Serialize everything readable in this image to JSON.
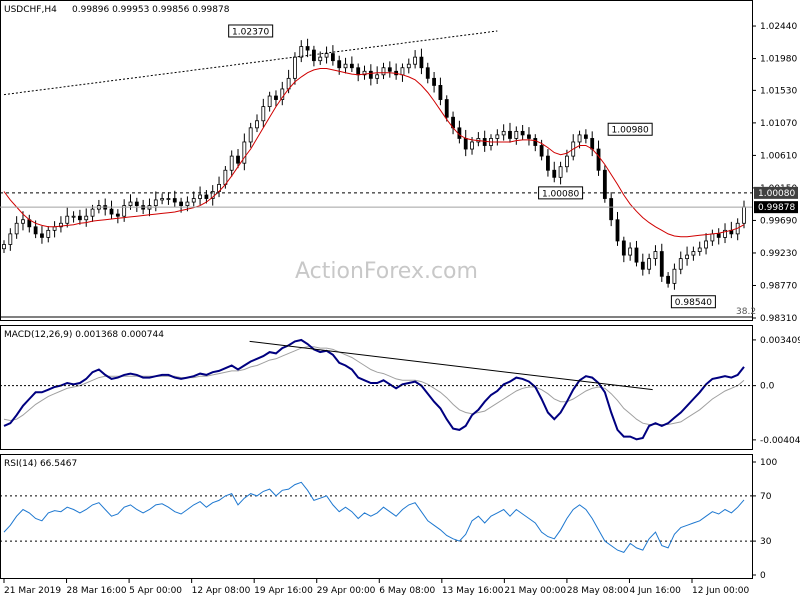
{
  "header": {
    "symbol": "USDCHF,H4",
    "ohlc": "0.99896 0.99953 0.99856 0.99878"
  },
  "watermark": "ActionForex.com",
  "chart_data": [
    {
      "type": "candlestick",
      "title": "USDCHF,H4",
      "ylim": [
        0.9831,
        1.0278
      ],
      "y_ticks": [
        "1.02440",
        "1.01980",
        "1.01530",
        "1.01070",
        "1.00610",
        "1.00150",
        "0.99690",
        "0.99230",
        "0.98770",
        "0.98310"
      ],
      "x_ticks": [
        "21 Mar 2019",
        "28 Mar 16:00",
        "5 Apr 00:00",
        "12 Apr 08:00",
        "19 Apr 16:00",
        "29 Apr 00:00",
        "6 May 08:00",
        "13 May 16:00",
        "21 May 00:00",
        "28 May 08:00",
        "4 Jun 16:00",
        "12 Jun 00:00"
      ],
      "last_price": "0.99878",
      "levels": [
        {
          "label": "1.00080",
          "value": 1.0008
        }
      ],
      "annotations": [
        {
          "label": "1.02370",
          "value": 1.0237
        },
        {
          "label": "1.00980",
          "value": 1.0098
        },
        {
          "label": "1.00080",
          "value": 1.0008
        },
        {
          "label": "0.98540",
          "value": 0.9854
        }
      ],
      "fib_label": "38.2",
      "trendline": [
        [
          0,
          1.0147
        ],
        [
          78,
          1.0237
        ]
      ],
      "closes": [
        0.9935,
        0.995,
        0.9965,
        0.997,
        0.996,
        0.995,
        0.9945,
        0.9955,
        0.996,
        0.9965,
        0.9975,
        0.9975,
        0.997,
        0.9975,
        0.9985,
        0.999,
        0.9985,
        0.9978,
        0.9975,
        0.999,
        0.9995,
        0.999,
        0.9985,
        0.999,
        0.9998,
        1.0,
        1.0,
        0.9995,
        0.999,
        0.9995,
        1.0,
        1.0005,
        1.0,
        1.001,
        1.002,
        1.004,
        1.006,
        1.005,
        1.008,
        1.01,
        1.011,
        1.013,
        1.0145,
        1.014,
        1.0155,
        1.017,
        1.02,
        1.0215,
        1.021,
        1.0195,
        1.02,
        1.0205,
        1.0195,
        1.0185,
        1.019,
        1.0185,
        1.0175,
        1.018,
        1.017,
        1.0175,
        1.0185,
        1.018,
        1.0175,
        1.0185,
        1.019,
        1.02,
        1.0185,
        1.017,
        1.016,
        1.014,
        1.0115,
        1.01,
        1.0085,
        1.007,
        1.008,
        1.0085,
        1.0075,
        1.0085,
        1.009,
        1.0095,
        1.0085,
        1.0095,
        1.009,
        1.0085,
        1.0075,
        1.006,
        1.004,
        1.003,
        1.0045,
        1.006,
        1.008,
        1.009,
        1.0085,
        1.007,
        1.004,
        1.0,
        0.997,
        0.994,
        0.992,
        0.993,
        0.991,
        0.99,
        0.9915,
        0.9925,
        0.989,
        0.988,
        0.99,
        0.9915,
        0.992,
        0.9925,
        0.993,
        0.994,
        0.995,
        0.9945,
        0.9955,
        0.995,
        0.9965,
        0.9988
      ],
      "ma_label": "",
      "ma": [
        1.001,
        0.9998,
        0.9988,
        0.9978,
        0.997,
        0.9965,
        0.9962,
        0.996,
        0.996,
        0.9961,
        0.9962,
        0.9963,
        0.9965,
        0.9966,
        0.9968,
        0.9969,
        0.997,
        0.9971,
        0.9972,
        0.9973,
        0.9974,
        0.9975,
        0.9976,
        0.9977,
        0.9978,
        0.9979,
        0.998,
        0.9981,
        0.9983,
        0.9985,
        0.9987,
        0.999,
        0.9995,
        1.0002,
        1.001,
        1.002,
        1.0032,
        1.0045,
        1.0058,
        1.007,
        1.0085,
        1.01,
        1.0115,
        1.013,
        1.0143,
        1.0155,
        1.0165,
        1.0172,
        1.0178,
        1.0182,
        1.0184,
        1.0184,
        1.0182,
        1.018,
        1.0178,
        1.0176,
        1.0175,
        1.0176,
        1.0177,
        1.0178,
        1.0178,
        1.0178,
        1.0177,
        1.0175,
        1.0172,
        1.0168,
        1.016,
        1.015,
        1.0138,
        1.0125,
        1.0112,
        1.01,
        1.009,
        1.0085,
        1.0083,
        1.0082,
        1.0081,
        1.008,
        1.008,
        1.008,
        1.008,
        1.0082,
        1.0083,
        1.0083,
        1.0082,
        1.0078,
        1.0072,
        1.0065,
        1.0062,
        1.0064,
        1.007,
        1.0075,
        1.0075,
        1.007,
        1.006,
        1.0048,
        1.0034,
        1.002,
        1.0005,
        0.9992,
        0.9982,
        0.9973,
        0.9966,
        0.996,
        0.9955,
        0.995,
        0.9947,
        0.9946,
        0.9946,
        0.9947,
        0.9948,
        0.9949,
        0.995,
        0.9951,
        0.9953,
        0.9955,
        0.9958,
        0.9963
      ]
    },
    {
      "type": "line",
      "title": "MACD(12,26,9) 0.001368 0.000744",
      "ylim": [
        -0.0045,
        0.0037
      ],
      "y_ticks": [
        "0.003409",
        "0.0",
        "-0.004043"
      ],
      "series": [
        {
          "name": "MACD(12,26,9)",
          "color": "#000080",
          "values": [
            -0.003,
            -0.0028,
            -0.0022,
            -0.0015,
            -0.001,
            -0.0005,
            -0.0005,
            -0.0003,
            -0.0001,
            0.0,
            0.0002,
            0.0001,
            0.0002,
            0.0005,
            0.001,
            0.0012,
            0.0008,
            0.0005,
            0.0006,
            0.0008,
            0.0009,
            0.0008,
            0.0006,
            0.0006,
            0.0007,
            0.0008,
            0.0008,
            0.0006,
            0.0005,
            0.0006,
            0.0007,
            0.0009,
            0.0008,
            0.001,
            0.0011,
            0.0013,
            0.0015,
            0.0012,
            0.0015,
            0.0018,
            0.002,
            0.0022,
            0.0025,
            0.0024,
            0.0028,
            0.003,
            0.0033,
            0.0034,
            0.0031,
            0.0027,
            0.0025,
            0.0026,
            0.0023,
            0.0017,
            0.0015,
            0.0012,
            0.0006,
            0.0004,
            0.0002,
            0.0002,
            0.0004,
            0.0001,
            -0.0002,
            0.0001,
            0.0002,
            0.0003,
            0.0,
            -0.0006,
            -0.0012,
            -0.0017,
            -0.0025,
            -0.0032,
            -0.0033,
            -0.003,
            -0.0022,
            -0.0018,
            -0.0012,
            -0.0007,
            -0.0004,
            0.0001,
            0.0003,
            0.0006,
            0.0005,
            0.0003,
            -0.0001,
            -0.001,
            -0.002,
            -0.0025,
            -0.002,
            -0.0012,
            -0.0003,
            0.0004,
            0.0007,
            0.0006,
            0.0002,
            -0.0005,
            -0.002,
            -0.0033,
            -0.0038,
            -0.0038,
            -0.004,
            -0.0039,
            -0.003,
            -0.0028,
            -0.003,
            -0.0028,
            -0.0024,
            -0.002,
            -0.0015,
            -0.001,
            -0.0005,
            0.0001,
            0.0005,
            0.0006,
            0.0007,
            0.0006,
            0.0008,
            0.0014
          ]
        },
        {
          "name": "Signal",
          "color": "#a0a0a0",
          "values": [
            -0.0025,
            -0.0026,
            -0.0025,
            -0.0022,
            -0.0018,
            -0.0014,
            -0.0011,
            -0.0008,
            -0.0006,
            -0.0004,
            -0.0002,
            -0.0001,
            0.0,
            0.0002,
            0.0004,
            0.0006,
            0.0007,
            0.0007,
            0.0007,
            0.0007,
            0.0007,
            0.0007,
            0.0007,
            0.0007,
            0.0007,
            0.0007,
            0.0007,
            0.0007,
            0.0006,
            0.0006,
            0.0006,
            0.0007,
            0.0007,
            0.0008,
            0.0009,
            0.001,
            0.0011,
            0.0011,
            0.0012,
            0.0014,
            0.0015,
            0.0017,
            0.0019,
            0.002,
            0.0022,
            0.0024,
            0.0026,
            0.0028,
            0.0029,
            0.0029,
            0.0028,
            0.0028,
            0.0027,
            0.0025,
            0.0023,
            0.0021,
            0.0018,
            0.0015,
            0.0012,
            0.001,
            0.0009,
            0.0007,
            0.0005,
            0.0004,
            0.0004,
            0.0004,
            0.0003,
            0.0001,
            -0.0002,
            -0.0005,
            -0.0009,
            -0.0014,
            -0.0018,
            -0.002,
            -0.0021,
            -0.002,
            -0.0019,
            -0.0016,
            -0.0013,
            -0.001,
            -0.0007,
            -0.0004,
            -0.0002,
            -0.0001,
            -0.0001,
            -0.0003,
            -0.0006,
            -0.001,
            -0.0012,
            -0.0012,
            -0.001,
            -0.0007,
            -0.0004,
            -0.0002,
            -0.0001,
            -0.0002,
            -0.0006,
            -0.0011,
            -0.0017,
            -0.0021,
            -0.0025,
            -0.0028,
            -0.0029,
            -0.0029,
            -0.0029,
            -0.0029,
            -0.0028,
            -0.0027,
            -0.0024,
            -0.0021,
            -0.0018,
            -0.0014,
            -0.001,
            -0.0007,
            -0.0004,
            -0.0002,
            0.0,
            0.0004
          ]
        }
      ],
      "trendline": [
        [
          78,
          0.0033
        ],
        [
          206,
          -0.0003
        ]
      ]
    },
    {
      "type": "line",
      "title": "RSI(14) 66.5467",
      "ylim": [
        0,
        100
      ],
      "y_ticks": [
        "100",
        "70",
        "30",
        "0"
      ],
      "levels": [
        70,
        30
      ],
      "series": [
        {
          "name": "RSI(14)",
          "color": "#1e78d0",
          "values": [
            38,
            44,
            52,
            58,
            55,
            50,
            48,
            55,
            57,
            56,
            60,
            58,
            55,
            58,
            62,
            64,
            58,
            52,
            54,
            60,
            62,
            58,
            55,
            58,
            62,
            63,
            60,
            56,
            54,
            58,
            62,
            65,
            60,
            64,
            66,
            70,
            72,
            62,
            68,
            72,
            70,
            74,
            76,
            70,
            75,
            76,
            80,
            82,
            75,
            66,
            68,
            70,
            62,
            56,
            60,
            56,
            50,
            55,
            52,
            55,
            60,
            56,
            52,
            58,
            62,
            64,
            56,
            48,
            44,
            40,
            35,
            32,
            30,
            36,
            48,
            52,
            46,
            52,
            55,
            58,
            52,
            58,
            54,
            50,
            46,
            38,
            34,
            32,
            40,
            50,
            58,
            62,
            58,
            50,
            40,
            30,
            26,
            22,
            20,
            28,
            24,
            22,
            32,
            38,
            26,
            24,
            36,
            42,
            44,
            46,
            48,
            52,
            56,
            54,
            58,
            55,
            60,
            66.5
          ]
        }
      ]
    }
  ]
}
